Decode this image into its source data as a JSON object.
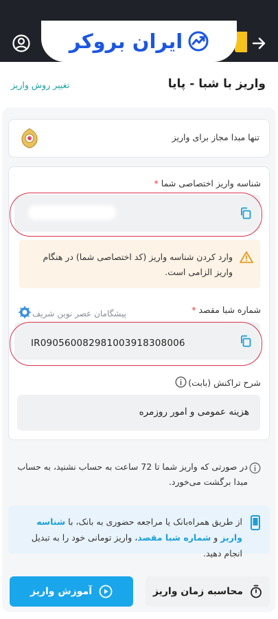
{
  "brand": {
    "logo_text": "ایران بروکر",
    "accent": "#1c56e0"
  },
  "header": {
    "title": "واریز با شبا - پایا",
    "change_method_link": "تغییر روش واریز"
  },
  "origin": {
    "text": "تنها مبدا مجاز برای واریز"
  },
  "deposit_id": {
    "label": "شناسه واریز اختصاصی شما",
    "required_mark": "*",
    "value": ""
  },
  "warning": {
    "text": "وارد کردن شناسه واریز (کد اختصاصی شما) در هنگام واریز الزامی است."
  },
  "iban": {
    "label": "شماره شبا مقصد",
    "required_mark": "*",
    "bank_name": "پیشگامان عصر نوین شریف",
    "value": "IR090560082981003918308006"
  },
  "description": {
    "label": "شرح تراکنش (بابت)",
    "value": "هزینه عمومی و امور روزمره"
  },
  "notice": {
    "text": "در صورتی که واریز شما تا 72 ساعت به حساب نشنید، به حساب مبدا برگشت می‌خورد."
  },
  "tip": {
    "part1": "از طریق همراه‌بانک یا مراجعه حضوری به بانک، با ",
    "hl1": "شناسه واریز",
    "part2": " و ",
    "hl2": "شماره شبا مقصد",
    "part3": "، واریز تومانی خود را به تبدیل انجام دهید."
  },
  "buttons": {
    "tutorial": "آموزش واریز",
    "calc_time": "محاسبه زمان واریز"
  },
  "colors": {
    "teal": "#1aa39d",
    "primary_button": "#1aa6ea",
    "highlight_ring": "#d6324a"
  }
}
